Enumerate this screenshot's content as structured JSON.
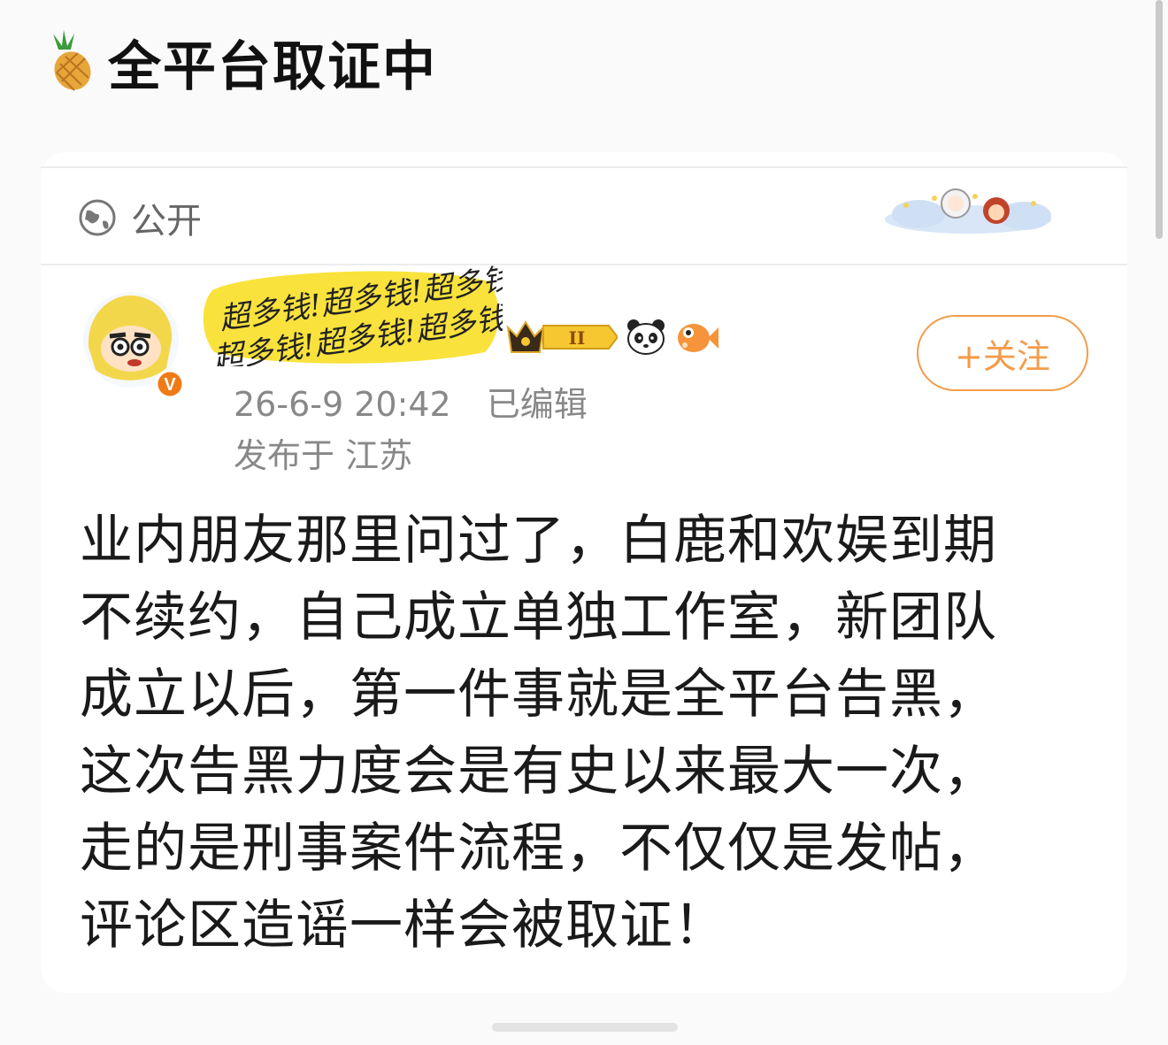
{
  "header": {
    "title": "全平台取证中",
    "icon": "pineapple-icon"
  },
  "post": {
    "visibility": "公开",
    "visibility_icon": "globe-icon",
    "author_banner_text": "超多钱!超多钱!超多钱!超多钱!超",
    "badges": [
      "crown-badge",
      "panda-icon",
      "fish-icon"
    ],
    "crown_level": "II",
    "follow_label": "+关注",
    "timestamp": "26-6-9 20:42",
    "edited": "已编辑",
    "location": "发布于 江苏",
    "body_lines": [
      "业内朋友那里问过了，白鹿和欢娱到期",
      "不续约，自己成立单独工作室，新团队",
      "成立以后，第一件事就是全平台告黑，",
      "这次告黑力度会是有史以来最大一次，",
      "走的是刑事案件流程，不仅仅是发帖，",
      "评论区造谣一样会被取证！"
    ]
  },
  "colors": {
    "accent": "#f39c4a",
    "verified": "#f07a16"
  }
}
